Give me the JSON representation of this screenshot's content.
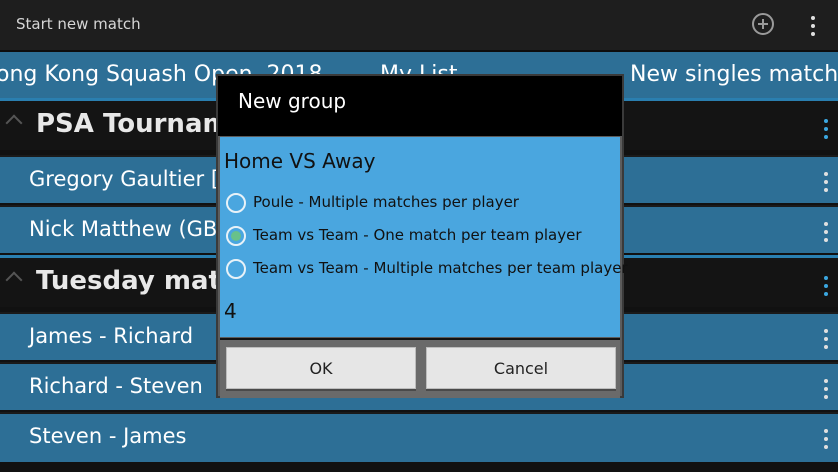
{
  "app": {
    "title": "Start new match",
    "add_icon": "add-circle-icon",
    "menu_icon": "overflow-menu-icon"
  },
  "tabs": [
    {
      "label": "ong Kong Squash Open, 2018"
    },
    {
      "label": "My List"
    },
    {
      "label": "New singles match"
    }
  ],
  "list": {
    "groups": [
      {
        "title": "PSA Tournament > Semi Finals",
        "items": [
          "Gregory Gaultier [FRA]",
          "Nick Matthew (GBR)"
        ]
      },
      {
        "title": "Tuesday match",
        "items": [
          "James - Richard",
          "Richard - Steven",
          "Steven - James"
        ]
      }
    ]
  },
  "dialog": {
    "title": "New group",
    "name_value": "Home VS Away",
    "options": [
      {
        "label": "Poule - Multiple matches per player",
        "checked": false
      },
      {
        "label": "Team vs Team - One match per team player",
        "checked": true
      },
      {
        "label": "Team vs Team - Multiple matches per team player",
        "checked": false
      }
    ],
    "count_value": "4",
    "ok_label": "OK",
    "cancel_label": "Cancel"
  },
  "colors": {
    "row_blue": "#2d6f96",
    "dialog_blue": "#4aa6df",
    "radio_checked": "#68c18a",
    "accent_line": "#2a7fb0"
  }
}
